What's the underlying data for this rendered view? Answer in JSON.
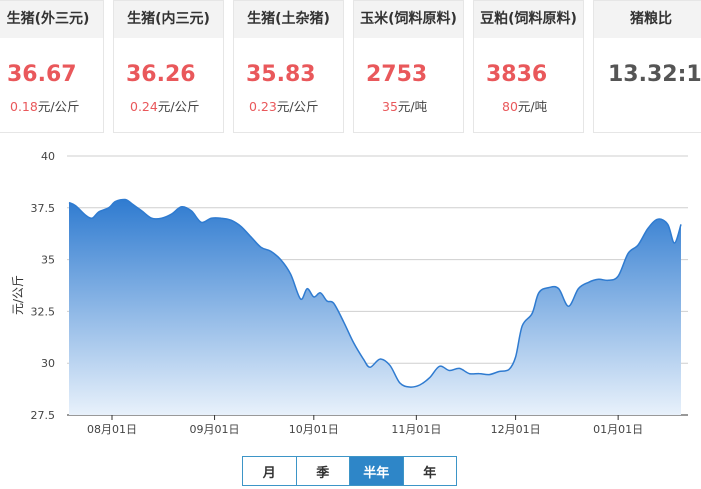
{
  "cards": [
    {
      "title": "生猪(外三元)",
      "price": "36.67",
      "change": "0.18",
      "unit": "元/公斤"
    },
    {
      "title": "生猪(内三元)",
      "price": "36.26",
      "change": "0.24",
      "unit": "元/公斤"
    },
    {
      "title": "生猪(土杂猪)",
      "price": "35.83",
      "change": "0.23",
      "unit": "元/公斤"
    },
    {
      "title": "玉米(饲料原料)",
      "price": "2753",
      "change": "35",
      "unit": "元/吨"
    },
    {
      "title": "豆粕(饲料原料)",
      "price": "3836",
      "change": "80",
      "unit": "元/吨"
    },
    {
      "title": "猪粮比",
      "price": "13.32:1"
    }
  ],
  "tabs": {
    "items": [
      "月",
      "季",
      "半年",
      "年"
    ],
    "active": "半年"
  },
  "colors": {
    "accent": "#e9585b",
    "line": "#2f7bd0",
    "fill_top": "#2f7bd0",
    "fill_bottom": "#e8f1fb",
    "tab_active": "#2e86c8"
  },
  "chart_data": {
    "type": "area",
    "ylabel": "元/公斤",
    "ylim": [
      27.5,
      40
    ],
    "yticks": [
      "27.5",
      "30",
      "32.5",
      "35",
      "37.5",
      "40"
    ],
    "xticks": [
      "08月01日",
      "09月01日",
      "10月01日",
      "11月01日",
      "12月01日",
      "01月01日"
    ],
    "x_range": [
      "07月19日",
      "01月18日"
    ],
    "grid": "horizontal",
    "series": [
      {
        "values": [
          [
            "07-19",
            37.75
          ],
          [
            "07-21",
            37.6
          ],
          [
            "07-24",
            37.15
          ],
          [
            "07-26",
            37.0
          ],
          [
            "07-28",
            37.3
          ],
          [
            "07-31",
            37.5
          ],
          [
            "08-02",
            37.8
          ],
          [
            "08-05",
            37.9
          ],
          [
            "08-07",
            37.7
          ],
          [
            "08-10",
            37.35
          ],
          [
            "08-13",
            37.0
          ],
          [
            "08-16",
            37.0
          ],
          [
            "08-19",
            37.2
          ],
          [
            "08-22",
            37.55
          ],
          [
            "08-25",
            37.35
          ],
          [
            "08-28",
            36.8
          ],
          [
            "08-31",
            37.0
          ],
          [
            "09-03",
            37.0
          ],
          [
            "09-06",
            36.9
          ],
          [
            "09-09",
            36.6
          ],
          [
            "09-12",
            36.1
          ],
          [
            "09-15",
            35.6
          ],
          [
            "09-18",
            35.4
          ],
          [
            "09-21",
            35.0
          ],
          [
            "09-24",
            34.3
          ],
          [
            "09-27",
            33.1
          ],
          [
            "09-29",
            33.6
          ],
          [
            "10-01",
            33.2
          ],
          [
            "10-03",
            33.4
          ],
          [
            "10-05",
            33.0
          ],
          [
            "10-07",
            32.9
          ],
          [
            "10-10",
            32.0
          ],
          [
            "10-13",
            31.0
          ],
          [
            "10-16",
            30.2
          ],
          [
            "10-18",
            29.8
          ],
          [
            "10-21",
            30.2
          ],
          [
            "10-24",
            29.9
          ],
          [
            "10-27",
            29.05
          ],
          [
            "10-30",
            28.85
          ],
          [
            "11-02",
            28.95
          ],
          [
            "11-05",
            29.3
          ],
          [
            "11-08",
            29.85
          ],
          [
            "11-11",
            29.65
          ],
          [
            "11-14",
            29.75
          ],
          [
            "11-17",
            29.5
          ],
          [
            "11-20",
            29.5
          ],
          [
            "11-23",
            29.45
          ],
          [
            "11-26",
            29.6
          ],
          [
            "11-29",
            29.7
          ],
          [
            "12-01",
            30.3
          ],
          [
            "12-03",
            31.8
          ],
          [
            "12-06",
            32.4
          ],
          [
            "12-08",
            33.4
          ],
          [
            "12-11",
            33.65
          ],
          [
            "12-14",
            33.6
          ],
          [
            "12-17",
            32.75
          ],
          [
            "12-20",
            33.6
          ],
          [
            "12-23",
            33.9
          ],
          [
            "12-26",
            34.05
          ],
          [
            "12-29",
            34.0
          ],
          [
            "01-01",
            34.2
          ],
          [
            "01-04",
            35.3
          ],
          [
            "01-07",
            35.7
          ],
          [
            "01-10",
            36.5
          ],
          [
            "01-13",
            36.95
          ],
          [
            "01-16",
            36.7
          ],
          [
            "01-18",
            35.8
          ],
          [
            "01-20",
            36.7
          ]
        ]
      }
    ]
  }
}
